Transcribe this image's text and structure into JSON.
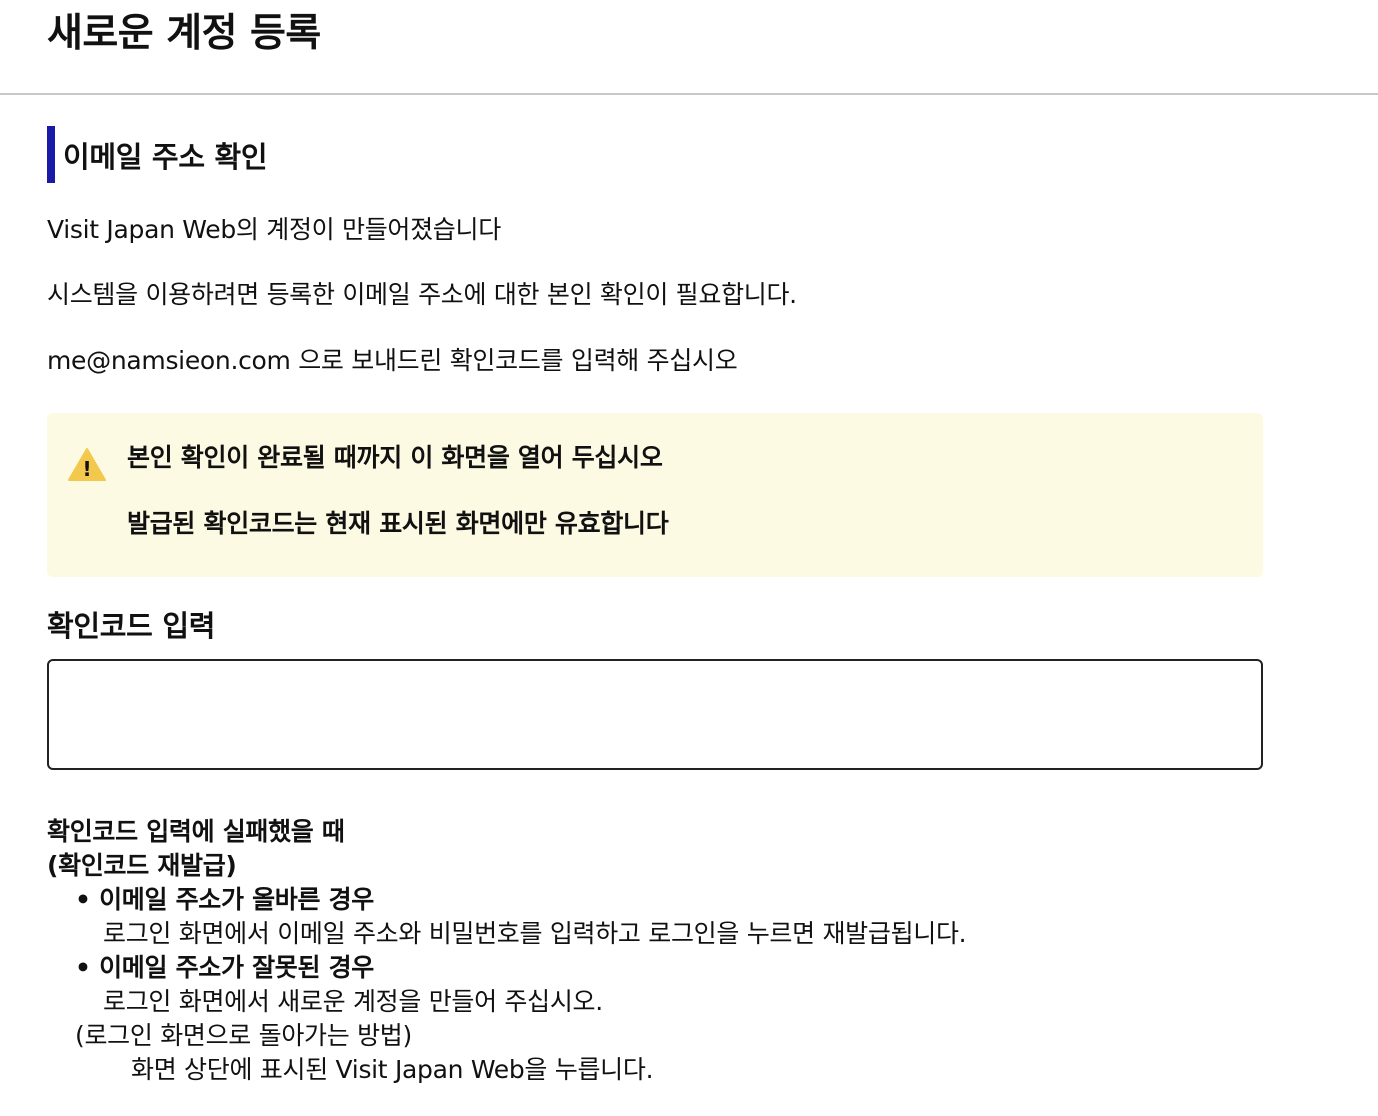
{
  "header": {
    "title": "새로운 계정 등록"
  },
  "section": {
    "heading": "이메일 주소 확인"
  },
  "intro": {
    "line1": "Visit Japan Web의 계정이 만들어졌습니다",
    "line2": "시스템을 이용하려면 등록한 이메일 주소에 대한 본인 확인이 필요합니다.",
    "line3": "me@namsieon.com 으로 보내드린 확인코드를 입력해 주십시오"
  },
  "notice": {
    "icon": "warning-icon",
    "line1": "본인 확인이 완료될 때까지 이 화면을 열어 두십시오",
    "line2": "발급된 확인코드는 현재 표시된 화면에만 유효합니다",
    "colors": {
      "background": "#fdfae3",
      "icon": "#f2c94c"
    }
  },
  "code_field": {
    "label": "확인코드 입력",
    "value": "",
    "placeholder": ""
  },
  "help": {
    "title_line1": "확인코드 입력에 실패했을 때",
    "title_line2": "(확인코드 재발급)",
    "case_correct_title": "• 이메일 주소가 올바른 경우",
    "case_correct_desc": "로그인 화면에서 이메일 주소와 비밀번호를 입력하고 로그인을 누르면 재발급됩니다.",
    "case_wrong_title": "• 이메일 주소가 잘못된 경우",
    "case_wrong_desc": "로그인 화면에서 새로운 계정을 만들어 주십시오.",
    "return_title": "(로그인 화면으로 돌아가는 방법)",
    "return_desc": "화면 상단에 표시된 Visit Japan Web을 누릅니다."
  },
  "colors": {
    "accent": "#1a1aa8",
    "divider": "#c8c8c8"
  }
}
